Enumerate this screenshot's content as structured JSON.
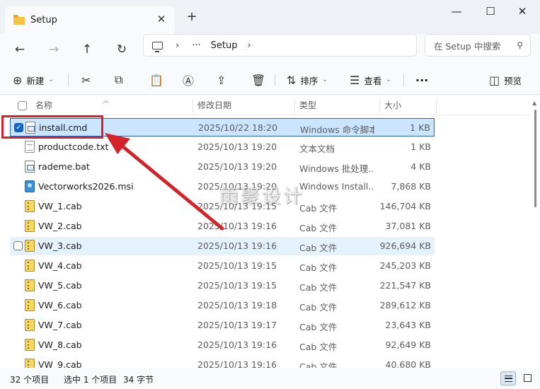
{
  "window": {
    "tab_title": "Setup",
    "new_tab_symbol": "+",
    "close_tab_symbol": "✕",
    "minimize_symbol": "—",
    "maximize_symbol": "☐",
    "close_symbol": "✕"
  },
  "address": {
    "more_crumbs": "···",
    "current_folder": "Setup",
    "search_placeholder": "在 Setup 中搜索"
  },
  "toolbar": {
    "new_label": "新建",
    "sort_label": "排序",
    "view_label": "查看",
    "more_label": "···",
    "preview_label": "预览"
  },
  "columns": {
    "name": "名称",
    "date": "修改日期",
    "type": "类型",
    "size": "大小"
  },
  "files": [
    {
      "name": "install.cmd",
      "date": "2025/10/22 18:20",
      "type": "Windows 命令脚本",
      "size": "1 KB",
      "icon": "cmd"
    },
    {
      "name": "productcode.txt",
      "date": "2025/10/13 19:20",
      "type": "文本文档",
      "size": "1 KB",
      "icon": "txt"
    },
    {
      "name": "rademe.bat",
      "date": "2025/10/13 19:20",
      "type": "Windows 批处理...",
      "size": "4 KB",
      "icon": "cmd"
    },
    {
      "name": "Vectorworks2026.msi",
      "date": "2025/10/13 19:20",
      "type": "Windows Install...",
      "size": "7,868 KB",
      "icon": "msi"
    },
    {
      "name": "VW_1.cab",
      "date": "2025/10/13 19:15",
      "type": "Cab 文件",
      "size": "146,704 KB",
      "icon": "cab"
    },
    {
      "name": "VW_2.cab",
      "date": "2025/10/13 19:16",
      "type": "Cab 文件",
      "size": "37,081 KB",
      "icon": "cab"
    },
    {
      "name": "VW_3.cab",
      "date": "2025/10/13 19:16",
      "type": "Cab 文件",
      "size": "926,694 KB",
      "icon": "cab"
    },
    {
      "name": "VW_4.cab",
      "date": "2025/10/13 19:15",
      "type": "Cab 文件",
      "size": "245,203 KB",
      "icon": "cab"
    },
    {
      "name": "VW_5.cab",
      "date": "2025/10/13 19:15",
      "type": "Cab 文件",
      "size": "221,547 KB",
      "icon": "cab"
    },
    {
      "name": "VW_6.cab",
      "date": "2025/10/13 19:18",
      "type": "Cab 文件",
      "size": "289,612 KB",
      "icon": "cab"
    },
    {
      "name": "VW_7.cab",
      "date": "2025/10/13 19:17",
      "type": "Cab 文件",
      "size": "23,643 KB",
      "icon": "cab"
    },
    {
      "name": "VW_8.cab",
      "date": "2025/10/13 19:16",
      "type": "Cab 文件",
      "size": "92,649 KB",
      "icon": "cab"
    },
    {
      "name": "VW_9.cab",
      "date": "2025/10/13 19:16",
      "type": "Cab 文件",
      "size": "40,680 KB",
      "icon": "cab"
    }
  ],
  "selected_index": 0,
  "hovered_index": 6,
  "status": {
    "item_count": "32 个项目",
    "selection": "选中 1 个项目",
    "selection_size": "34 字节"
  },
  "watermark": "雨聚设计",
  "colors": {
    "accent": "#1565c0",
    "annotation_red": "#d3232b",
    "selection_bg": "#cce5ff"
  }
}
